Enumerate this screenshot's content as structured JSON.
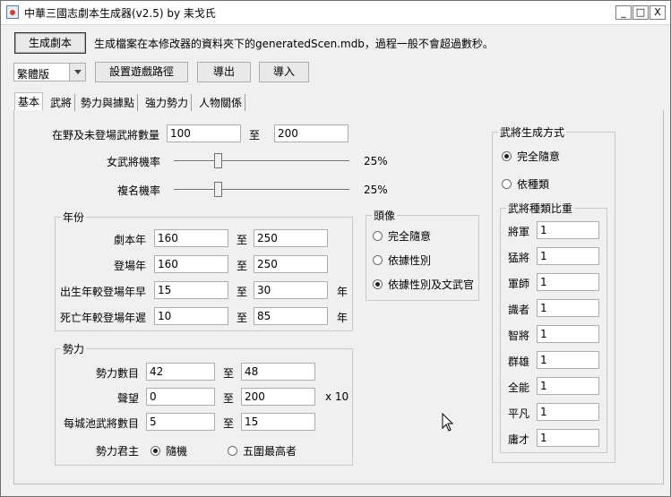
{
  "window": {
    "title": "中華三國志劇本生成器(v2.5) by 耒戈氏",
    "controls": [
      "_",
      "□",
      "X"
    ]
  },
  "toolbar": {
    "generate_label": "生成劇本",
    "info_text": "生成檔案在本修改器的資料夾下的generatedScen.mdb，過程一般不會超過數秒。",
    "language_selected": "繁體版",
    "set_path_label": "設置遊戲路徑",
    "export_label": "導出",
    "import_label": "導入"
  },
  "tabs": [
    "基本",
    "武將",
    "勢力與據點",
    "強力勢力",
    "人物關係"
  ],
  "basic": {
    "officer_count_label": "在野及未登場武將數量",
    "officer_count_min": "100",
    "officer_count_max": "200",
    "to": "至",
    "female_label": "女武將機率",
    "female_pct": "25%",
    "female_value": 25,
    "dup_name_label": "複名機率",
    "dup_name_pct": "25%",
    "dup_name_value": 25
  },
  "year": {
    "title": "年份",
    "rows": [
      {
        "label": "劇本年",
        "min": "160",
        "max": "250",
        "unit": ""
      },
      {
        "label": "登場年",
        "min": "160",
        "max": "250",
        "unit": ""
      },
      {
        "label": "出生年較登場年早",
        "min": "15",
        "max": "30",
        "unit": "年"
      },
      {
        "label": "死亡年較登場年遲",
        "min": "10",
        "max": "85",
        "unit": "年"
      }
    ]
  },
  "portrait": {
    "title": "頭像",
    "options": [
      "完全隨意",
      "依據性別",
      "依據性別及文武官"
    ],
    "selected": 2
  },
  "force": {
    "title": "勢力",
    "rows": [
      {
        "label": "勢力數目",
        "min": "42",
        "max": "48",
        "unit": ""
      },
      {
        "label": "聲望",
        "min": "0",
        "max": "200",
        "unit": "x 10"
      },
      {
        "label": "每城池武將數目",
        "min": "5",
        "max": "15",
        "unit": ""
      }
    ],
    "ruler_label": "勢力君主",
    "ruler_options": [
      "隨機",
      "五圍最高者"
    ],
    "ruler_selected": 0
  },
  "generation": {
    "title": "武將生成方式",
    "options": [
      "完全隨意",
      "依種類"
    ],
    "selected": 0,
    "weights_title": "武將種類比重",
    "weights": [
      {
        "label": "將軍",
        "value": "1"
      },
      {
        "label": "猛將",
        "value": "1"
      },
      {
        "label": "軍師",
        "value": "1"
      },
      {
        "label": "識者",
        "value": "1"
      },
      {
        "label": "智將",
        "value": "1"
      },
      {
        "label": "群雄",
        "value": "1"
      },
      {
        "label": "全能",
        "value": "1"
      },
      {
        "label": "平凡",
        "value": "1"
      },
      {
        "label": "庸才",
        "value": "1"
      }
    ]
  }
}
